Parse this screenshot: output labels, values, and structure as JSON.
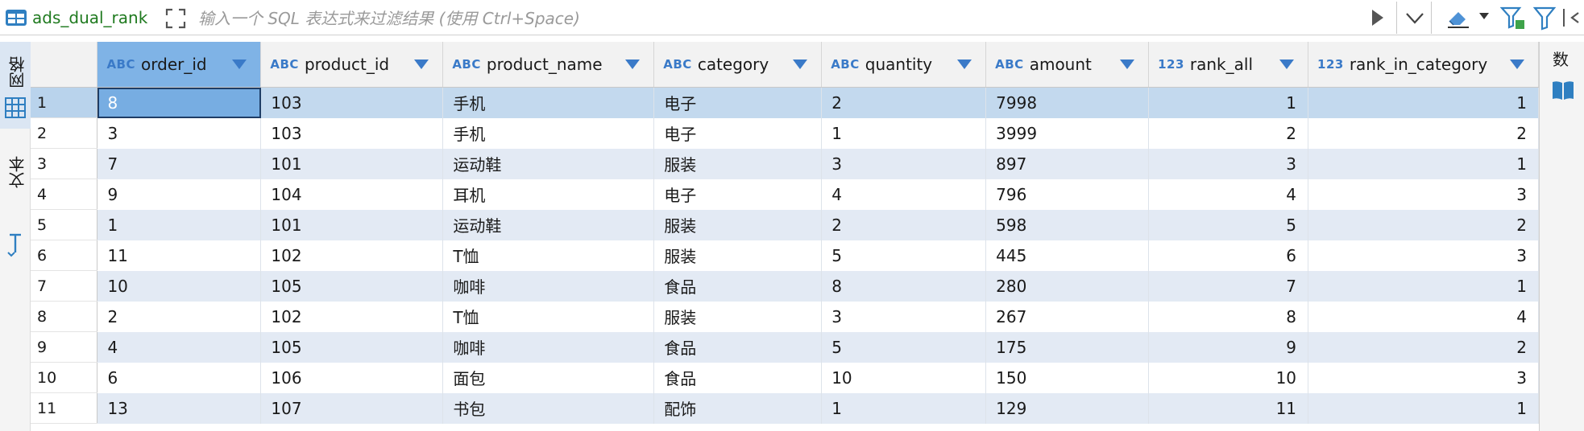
{
  "toolbar": {
    "table_name": "ads_dual_rank",
    "filter_placeholder": "输入一个 SQL 表达式来过滤结果 (使用 Ctrl+Space)",
    "icons": [
      "table-icon",
      "expand-icon",
      "play-icon",
      "chevron-down-icon",
      "eraser-icon",
      "filter-settings-icon",
      "filter-icon",
      "panel-left-icon"
    ]
  },
  "left_tabs": {
    "grid_label": "网格",
    "text_label": "文本"
  },
  "right_panel": {
    "label": "数"
  },
  "grid": {
    "columns": [
      {
        "type": "ABC",
        "name": "order_id"
      },
      {
        "type": "ABC",
        "name": "product_id"
      },
      {
        "type": "ABC",
        "name": "product_name"
      },
      {
        "type": "ABC",
        "name": "category"
      },
      {
        "type": "ABC",
        "name": "quantity"
      },
      {
        "type": "ABC",
        "name": "amount"
      },
      {
        "type": "123",
        "name": "rank_all"
      },
      {
        "type": "123",
        "name": "rank_in_category"
      }
    ],
    "rows": [
      {
        "num": "1",
        "cells": [
          "8",
          "103",
          "手机",
          "电子",
          "2",
          "7998",
          "1",
          "1"
        ]
      },
      {
        "num": "2",
        "cells": [
          "3",
          "103",
          "手机",
          "电子",
          "1",
          "3999",
          "2",
          "2"
        ]
      },
      {
        "num": "3",
        "cells": [
          "7",
          "101",
          "运动鞋",
          "服装",
          "3",
          "897",
          "3",
          "1"
        ]
      },
      {
        "num": "4",
        "cells": [
          "9",
          "104",
          "耳机",
          "电子",
          "4",
          "796",
          "4",
          "3"
        ]
      },
      {
        "num": "5",
        "cells": [
          "1",
          "101",
          "运动鞋",
          "服装",
          "2",
          "598",
          "5",
          "2"
        ]
      },
      {
        "num": "6",
        "cells": [
          "11",
          "102",
          "T恤",
          "服装",
          "5",
          "445",
          "6",
          "3"
        ]
      },
      {
        "num": "7",
        "cells": [
          "10",
          "105",
          "咖啡",
          "食品",
          "8",
          "280",
          "7",
          "1"
        ]
      },
      {
        "num": "8",
        "cells": [
          "2",
          "102",
          "T恤",
          "服装",
          "3",
          "267",
          "8",
          "4"
        ]
      },
      {
        "num": "9",
        "cells": [
          "4",
          "105",
          "咖啡",
          "食品",
          "5",
          "175",
          "9",
          "2"
        ]
      },
      {
        "num": "10",
        "cells": [
          "6",
          "106",
          "面包",
          "食品",
          "10",
          "150",
          "10",
          "3"
        ]
      },
      {
        "num": "11",
        "cells": [
          "13",
          "107",
          "书包",
          "配饰",
          "1",
          "129",
          "11",
          "1"
        ]
      }
    ]
  },
  "colors": {
    "selected_header": "#7fb3e6",
    "selected_row": "#c3d9ee",
    "stripe": "#e3eaf4",
    "type_badge": "#3a7ac8",
    "table_name": "#1f7a1f"
  }
}
